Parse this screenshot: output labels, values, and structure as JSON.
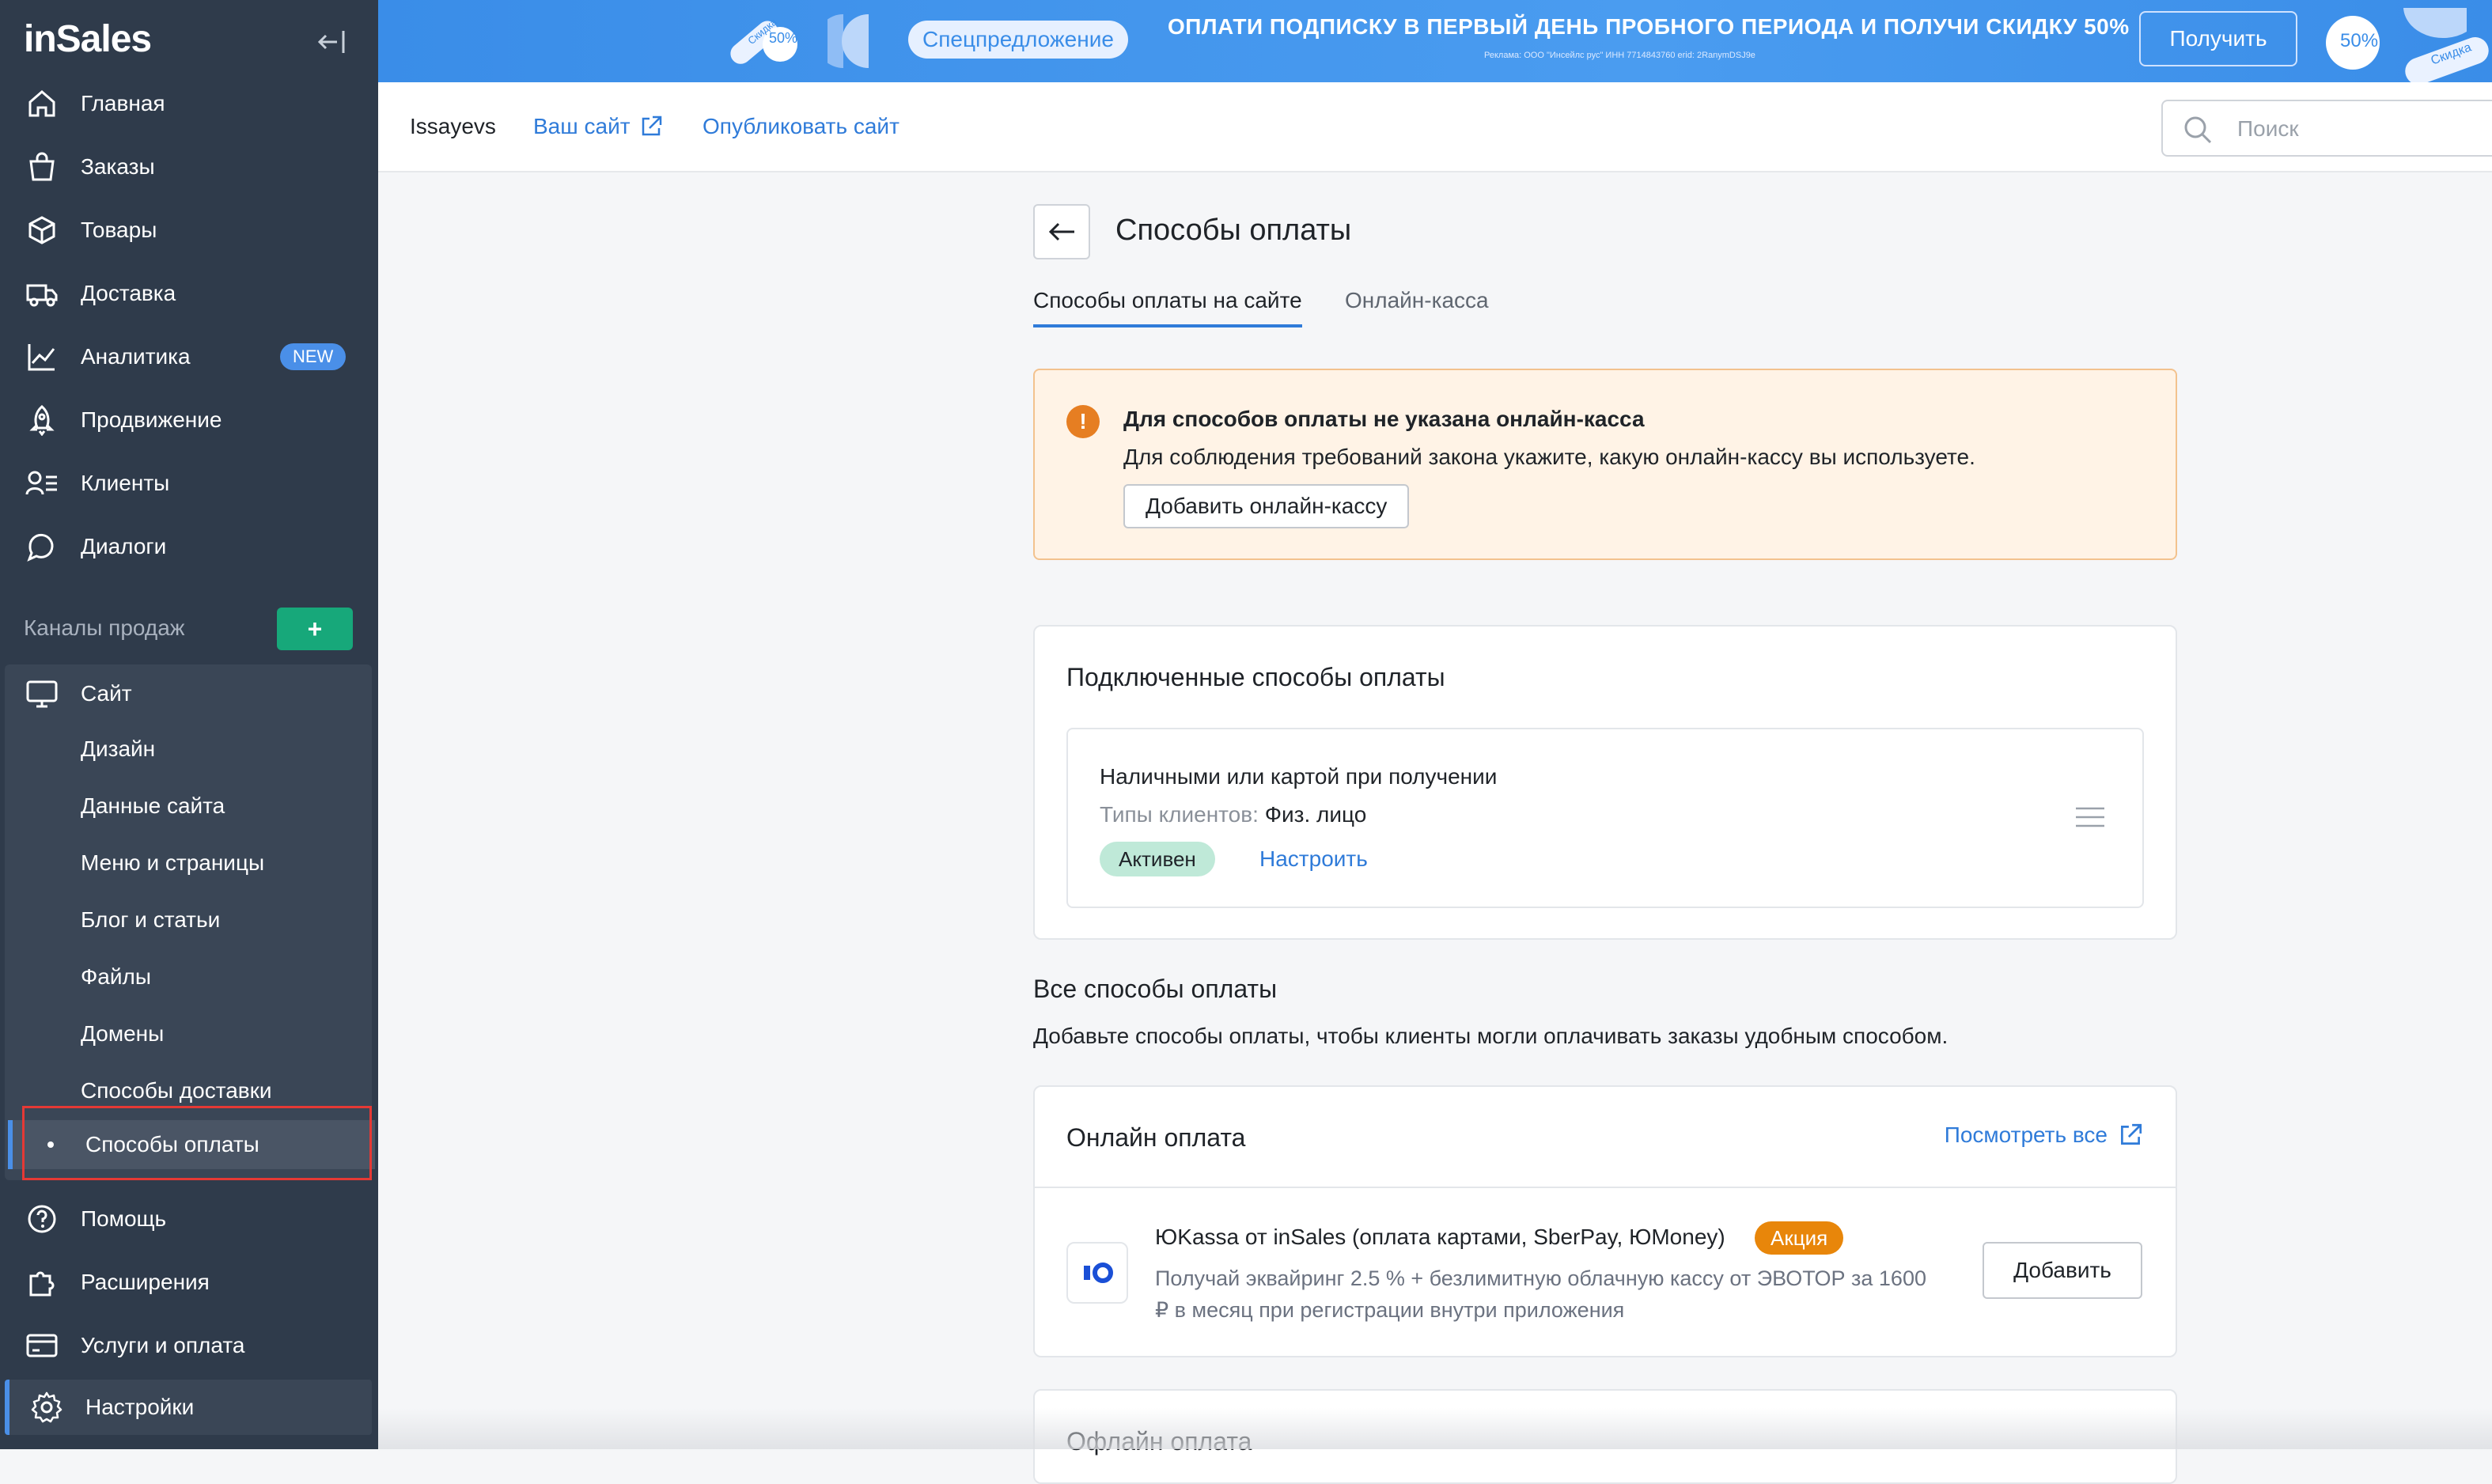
{
  "app": {
    "logo_text": "inSales"
  },
  "colors": {
    "sidebar_bg": "#2f3b4b",
    "accent": "#2f7bd9",
    "success": "#17a87a",
    "warning": "#e67e22",
    "promo": "#e8860a"
  },
  "sidebar": {
    "main_items": [
      {
        "label": "Главная",
        "icon": "home-icon"
      },
      {
        "label": "Заказы",
        "icon": "shopping-bag-icon"
      },
      {
        "label": "Товары",
        "icon": "box-icon"
      },
      {
        "label": "Доставка",
        "icon": "truck-icon"
      },
      {
        "label": "Аналитика",
        "icon": "chart-line-icon",
        "badge": "NEW"
      },
      {
        "label": "Продвижение",
        "icon": "rocket-icon"
      },
      {
        "label": "Клиенты",
        "icon": "users-icon"
      },
      {
        "label": "Диалоги",
        "icon": "chat-icon"
      }
    ],
    "channels_title": "Каналы продаж",
    "channels_add": "+",
    "site": {
      "label": "Сайт",
      "sub_items": [
        "Дизайн",
        "Данные сайта",
        "Меню и страницы",
        "Блог и статьи",
        "Файлы",
        "Домены",
        "Способы доставки",
        "Способы оплаты"
      ],
      "active_item": "Способы оплаты"
    },
    "bottom_items": [
      {
        "label": "Помощь",
        "icon": "help-icon"
      },
      {
        "label": "Расширения",
        "icon": "puzzle-icon"
      },
      {
        "label": "Услуги и оплата",
        "icon": "card-icon"
      },
      {
        "label": "Настройки",
        "icon": "gear-icon"
      }
    ]
  },
  "promo": {
    "sticker_left": "Скидка",
    "percent": "50%",
    "chip": "Спецпредложение",
    "title": "ОПЛАТИ ПОДПИСКУ В ПЕРВЫЙ ДЕНЬ ПРОБНОГО ПЕРИОДА И ПОЛУЧИ СКИДКУ 50%",
    "fine_print": "Реклама: ООО \"Инсейлс рус\" ИНН 7714843760 erid: 2RanymDSJ9e",
    "button": "Получить",
    "sticker_right": "Скидка"
  },
  "header": {
    "account": "Issayevs",
    "your_site": "Ваш сайт",
    "publish": "Опубликовать сайт",
    "search_placeholder": "Поиск"
  },
  "page": {
    "title": "Способы оплаты",
    "tabs": [
      "Способы оплаты на сайте",
      "Онлайн-касса"
    ],
    "alert": {
      "icon": "!",
      "title": "Для способов оплаты не указана онлайн-касса",
      "text": "Для соблюдения требований закона укажите, какую онлайн-кассу вы используете.",
      "button": "Добавить онлайн-кассу"
    },
    "connected": {
      "title": "Подключенные способы оплаты",
      "method_name": "Наличными или картой при получении",
      "types_label": "Типы клиентов:",
      "types_value": "Физ. лицо",
      "status": "Активен",
      "configure": "Настроить"
    },
    "all": {
      "title": "Все способы оплаты",
      "subtitle": "Добавьте способы оплаты, чтобы клиенты могли оплачивать заказы удобным способом."
    },
    "online": {
      "title": "Онлайн оплата",
      "see_all": "Посмотреть все",
      "provider_name": "ЮKassa от inSales (оплата картами, SberPay, ЮMoney)",
      "provider_badge": "Акция",
      "provider_desc": "Получай эквайринг 2.5 % + безлимитную облачную кассу от ЭВОТОР за 1600 ₽ в месяц при регистрации внутри приложения",
      "add_button": "Добавить"
    },
    "offline": {
      "title": "Офлайн оплата"
    }
  }
}
